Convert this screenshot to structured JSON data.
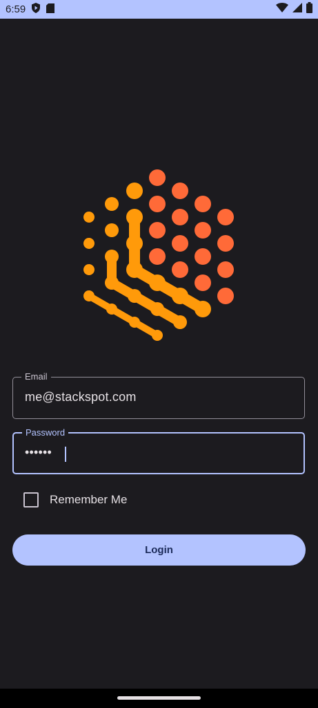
{
  "status_bar": {
    "time": "6:59",
    "icons": [
      "shield-play-icon",
      "sd-card-icon",
      "wifi-icon",
      "signal-icon",
      "battery-icon"
    ]
  },
  "colors": {
    "accent": "#b3c3ff",
    "background": "#1c1b1f",
    "logo_orange": "#ff9a0a",
    "logo_red": "#ff6a38"
  },
  "form": {
    "email": {
      "label": "Email",
      "value": "me@stackspot.com"
    },
    "password": {
      "label": "Password",
      "value": "••••••"
    },
    "remember_me": {
      "label": "Remember Me",
      "checked": false
    },
    "login_label": "Login"
  }
}
